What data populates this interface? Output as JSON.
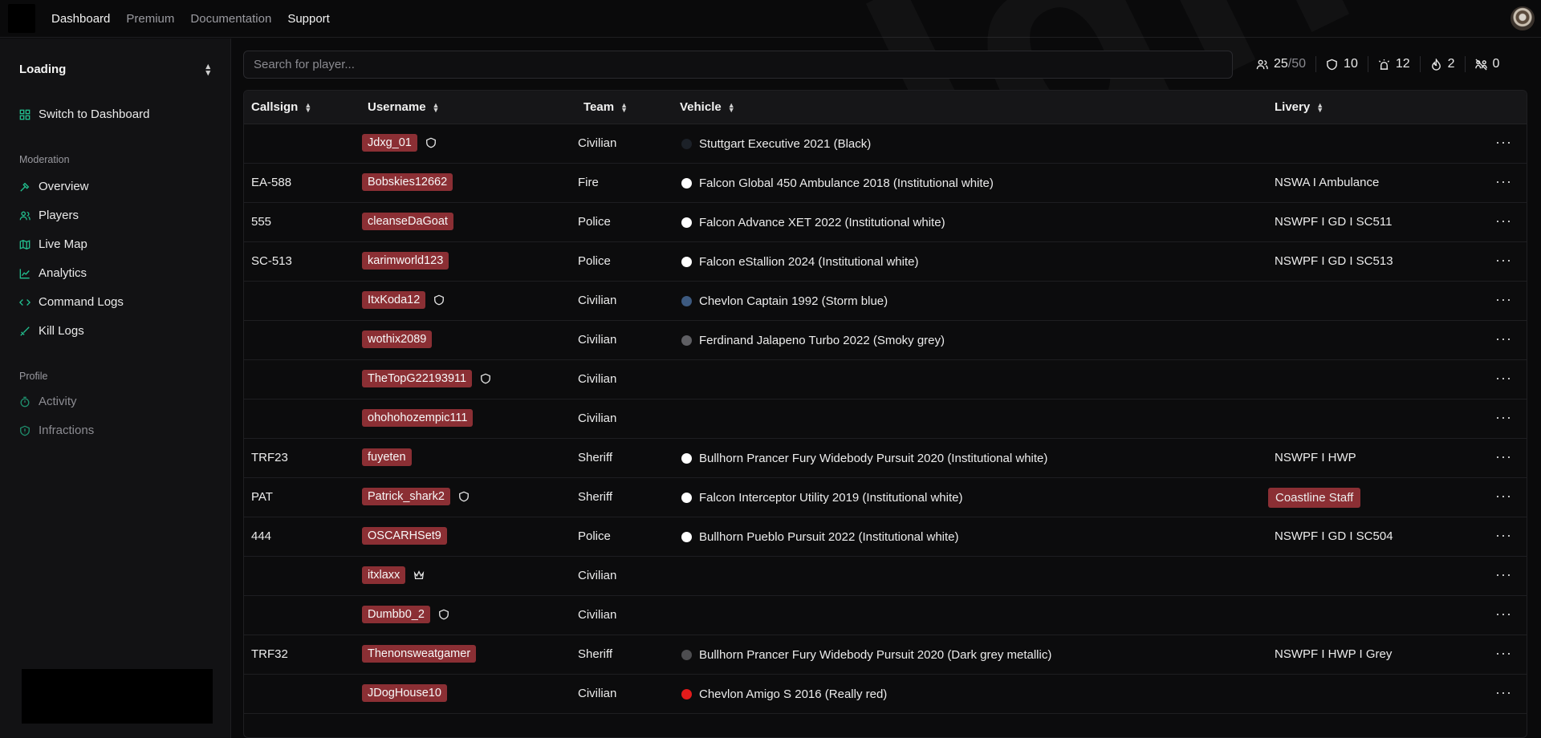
{
  "topnav": {
    "items": [
      "Dashboard",
      "Premium",
      "Documentation",
      "Support"
    ]
  },
  "sidebar": {
    "org_name": "Loading",
    "switch_label": "Switch to Dashboard",
    "moderation_label": "Moderation",
    "moderation_items": [
      "Overview",
      "Players",
      "Live Map",
      "Analytics",
      "Command Logs",
      "Kill Logs"
    ],
    "profile_label": "Profile",
    "profile_items": [
      "Activity",
      "Infractions"
    ]
  },
  "search": {
    "placeholder": "Search for player..."
  },
  "stats": {
    "players": "25",
    "players_max": "/50",
    "staff": "10",
    "police": "12",
    "fire": "2",
    "queue": "0"
  },
  "table": {
    "headers": [
      "Callsign",
      "Username",
      "Team",
      "Vehicle",
      "Livery"
    ],
    "rows": [
      {
        "callsign": "",
        "username": "Jdxg_01",
        "icon": "shield-icon",
        "team": "Civilian",
        "vehicle": "Stuttgart Executive 2021 (Black)",
        "vehicle_color": "#1c2128",
        "livery": ""
      },
      {
        "callsign": "EA-588",
        "username": "Bobskies12662",
        "icon": "",
        "team": "Fire",
        "vehicle": "Falcon Global 450 Ambulance 2018 (Institutional white)",
        "vehicle_color": "#ffffff",
        "livery": "NSWA I Ambulance"
      },
      {
        "callsign": "555",
        "username": "cleanseDaGoat",
        "icon": "",
        "team": "Police",
        "vehicle": "Falcon Advance XET 2022 (Institutional white)",
        "vehicle_color": "#ffffff",
        "livery": "NSWPF I GD I SC511"
      },
      {
        "callsign": "SC-513",
        "username": "karimworld123",
        "icon": "",
        "team": "Police",
        "vehicle": "Falcon eStallion 2024 (Institutional white)",
        "vehicle_color": "#ffffff",
        "livery": "NSWPF I GD I SC513"
      },
      {
        "callsign": "",
        "username": "ItxKoda12",
        "icon": "shield-icon",
        "team": "Civilian",
        "vehicle": "Chevlon Captain 1992 (Storm blue)",
        "vehicle_color": "#3d5a80",
        "livery": ""
      },
      {
        "callsign": "",
        "username": "wothix2089",
        "icon": "",
        "team": "Civilian",
        "vehicle": "Ferdinand Jalapeno Turbo 2022 (Smoky grey)",
        "vehicle_color": "#5f5f63",
        "livery": ""
      },
      {
        "callsign": "",
        "username": "TheTopG22193911",
        "icon": "shield-icon",
        "team": "Civilian",
        "vehicle": "",
        "vehicle_color": "",
        "livery": ""
      },
      {
        "callsign": "",
        "username": "ohohohozempic111",
        "icon": "",
        "team": "Civilian",
        "vehicle": "",
        "vehicle_color": "",
        "livery": ""
      },
      {
        "callsign": "TRF23",
        "username": "fuyeten",
        "icon": "",
        "team": "Sheriff",
        "vehicle": "Bullhorn Prancer Fury Widebody Pursuit 2020 (Institutional white)",
        "vehicle_color": "#ffffff",
        "livery": "NSWPF I HWP"
      },
      {
        "callsign": "PAT",
        "username": "Patrick_shark2",
        "icon": "shield-icon",
        "team": "Sheriff",
        "vehicle": "Falcon Interceptor Utility 2019 (Institutional white)",
        "vehicle_color": "#ffffff",
        "livery": "Coastline Staff",
        "livery_tag": true
      },
      {
        "callsign": "444",
        "username": "OSCARHSet9",
        "icon": "",
        "team": "Police",
        "vehicle": "Bullhorn Pueblo Pursuit 2022 (Institutional white)",
        "vehicle_color": "#ffffff",
        "livery": "NSWPF I GD I SC504"
      },
      {
        "callsign": "",
        "username": "itxlaxx",
        "icon": "crown-icon",
        "team": "Civilian",
        "vehicle": "",
        "vehicle_color": "",
        "livery": ""
      },
      {
        "callsign": "",
        "username": "Dumbb0_2",
        "icon": "shield-icon",
        "team": "Civilian",
        "vehicle": "",
        "vehicle_color": "",
        "livery": ""
      },
      {
        "callsign": "TRF32",
        "username": "Thenonsweatgamer",
        "icon": "",
        "team": "Sheriff",
        "vehicle": "Bullhorn Prancer Fury Widebody Pursuit 2020 (Dark grey metallic)",
        "vehicle_color": "#4d4d50",
        "livery": "NSWPF I HWP I Grey"
      },
      {
        "callsign": "",
        "username": "JDogHouse10",
        "icon": "",
        "team": "Civilian",
        "vehicle": "Chevlon Amigo S 2016 (Really red)",
        "vehicle_color": "#e31b1b",
        "livery": ""
      }
    ]
  },
  "watermark": "aez.lgn.au",
  "colors": {
    "accent": "#22c08f",
    "badge": "#8b2f34",
    "background": "#0a0a0b",
    "sidebar": "#121214"
  }
}
